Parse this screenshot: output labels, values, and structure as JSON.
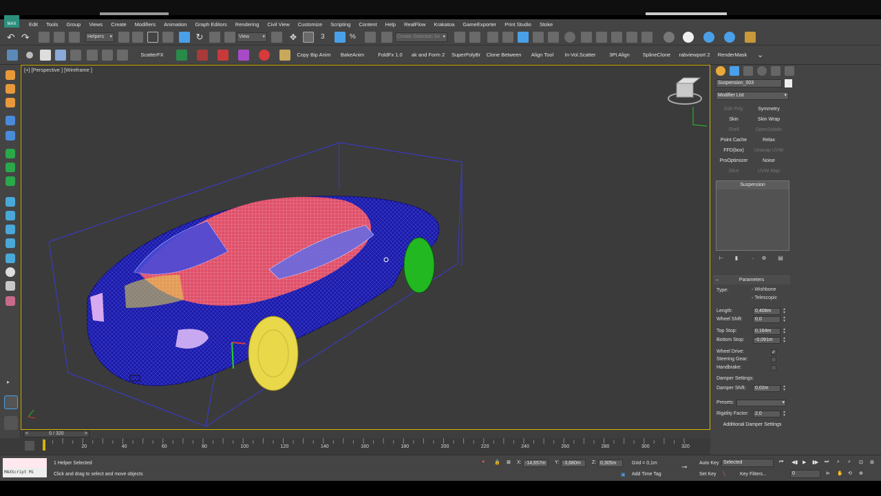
{
  "app": {
    "logo_text": "MAX"
  },
  "menu": [
    "Edit",
    "Tools",
    "Group",
    "Views",
    "Create",
    "Modifiers",
    "Animation",
    "Graph Editors",
    "Rendering",
    "Civil View",
    "Customize",
    "Scripting",
    "Content",
    "Help",
    "RealFlow",
    "Krakatoa",
    "GameExporter",
    "Print Studio",
    "Stoke"
  ],
  "toolbar1": {
    "selection_filter": "Helpers",
    "ref_coord": "View",
    "named_selection_placeholder": "Create Selection Se"
  },
  "toolbar2": {
    "buttons": [
      "ScatterFX",
      "Copy Bip Anim",
      "BakeAnim",
      "FoldFx 1.0",
      "ak and Form 2",
      "SuperPolyBr",
      "Clone Between",
      "Align Tool",
      "In-Vol.Scatter",
      "3Pt Align",
      "SplineClone",
      "rabviewport 2",
      "RenderMask"
    ]
  },
  "viewport": {
    "label": "[+] [Perspective ] [Wireframe ]",
    "colors": {
      "body": "#1a1aa8",
      "interior": "#e0506a",
      "front_wheel": "#e8d84a",
      "rear_wheel": "#22b822",
      "bbox": "#3a3ad8"
    }
  },
  "command_panel": {
    "object_name": "Suspension_003",
    "modifier_list": "Modifier List",
    "modifier_buttons": [
      {
        "label": "Edit Poly",
        "enabled": false
      },
      {
        "label": "Symmetry",
        "enabled": true
      },
      {
        "label": "Skin",
        "enabled": true
      },
      {
        "label": "Skin Wrap",
        "enabled": true
      },
      {
        "label": "Shell",
        "enabled": false
      },
      {
        "label": "OpenSubdiv",
        "enabled": false
      },
      {
        "label": "Point Cache",
        "enabled": true
      },
      {
        "label": "Relax",
        "enabled": true
      },
      {
        "label": "FFD(box)",
        "enabled": true
      },
      {
        "label": "Unwrap UVW",
        "enabled": false
      },
      {
        "label": "ProOptimizer",
        "enabled": true
      },
      {
        "label": "Noise",
        "enabled": true
      },
      {
        "label": "Slice",
        "enabled": false
      },
      {
        "label": "UVW Map",
        "enabled": false
      }
    ],
    "stack_item": "Suspension",
    "parameters": {
      "title": "Parameters",
      "type_label": "Type:",
      "type_options": [
        "Wishbone",
        "Telescopic"
      ],
      "length_label": "Length:",
      "length": "0,408m",
      "wheel_shift_label": "Wheel Shift:",
      "wheel_shift": "0,0",
      "top_stop_label": "Top Stop:",
      "top_stop": "0,164m",
      "bottom_stop_label": "Bottom Stop:",
      "bottom_stop": "-0,091m",
      "wheel_drive_label": "Wheel Drive:",
      "wheel_drive": true,
      "steering_gear_label": "Steering Gear:",
      "steering_gear": false,
      "handbrake_label": "Handbrake:",
      "handbrake": false,
      "damper_settings_label": "Damper Settings:",
      "damper_shift_label": "Damper Shift:",
      "damper_shift": "0,02m",
      "presets_label": "Presets:",
      "rigidity_label": "Rigidity Factor:",
      "rigidity": "2,0",
      "additional_damper": "Additional Damper Settings"
    }
  },
  "timeline": {
    "slider_text": "0 / 320",
    "ticks": [
      "20",
      "40",
      "60",
      "80",
      "100",
      "120",
      "140",
      "160",
      "180",
      "200",
      "220",
      "240",
      "260",
      "280",
      "300",
      "320"
    ]
  },
  "status": {
    "maxscript": "MAXScript Mi",
    "selection": "1 Helper Selected",
    "prompt": "Click and drag to select and move objects",
    "x_label": "X:",
    "x": "-14,657m",
    "y_label": "Y:",
    "y": "-3,680m",
    "z_label": "Z:",
    "z": "0,305m",
    "grid": "Grid = 0,1m",
    "add_time_tag": "Add Time Tag",
    "auto_key": "Auto Key",
    "auto_key_mode": "Selected",
    "set_key": "Set Key",
    "key_filters": "Key Filters...",
    "frame": "0"
  }
}
